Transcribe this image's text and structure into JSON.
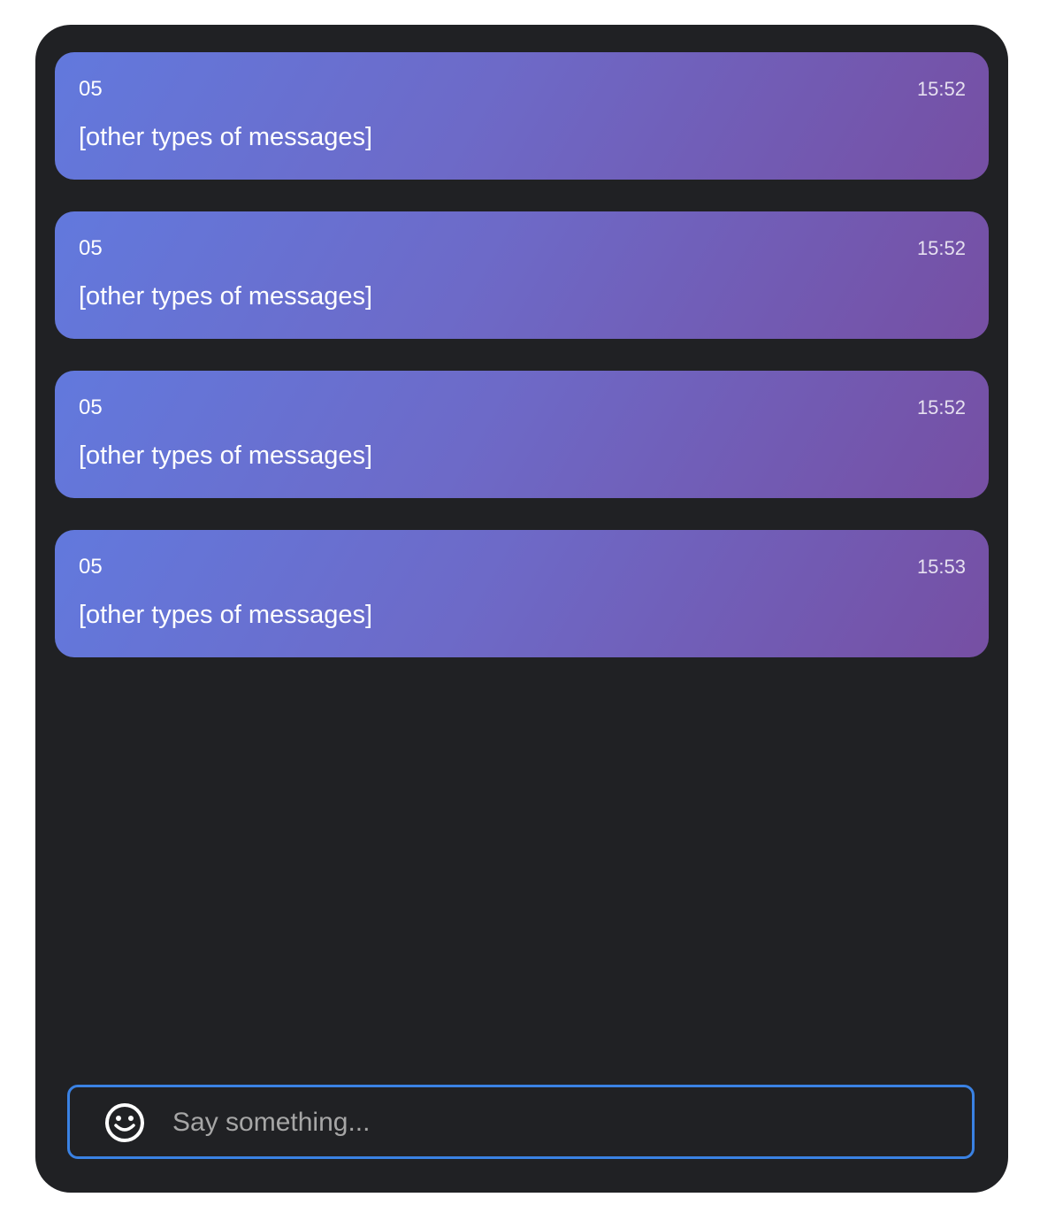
{
  "messages": [
    {
      "user": "05",
      "time": "15:52",
      "text": "[other types of messages]"
    },
    {
      "user": "05",
      "time": "15:52",
      "text": "[other types of messages]"
    },
    {
      "user": "05",
      "time": "15:52",
      "text": "[other types of messages]"
    },
    {
      "user": "05",
      "time": "15:53",
      "text": "[other types of messages]"
    }
  ],
  "input": {
    "placeholder": "Say something...",
    "value": "",
    "emoji_icon": "smiley-face-icon"
  },
  "colors": {
    "panel_bg": "#202124",
    "bubble_gradient_start": "#6279dd",
    "bubble_gradient_end": "#764fa3",
    "input_border": "#3a82e4"
  }
}
